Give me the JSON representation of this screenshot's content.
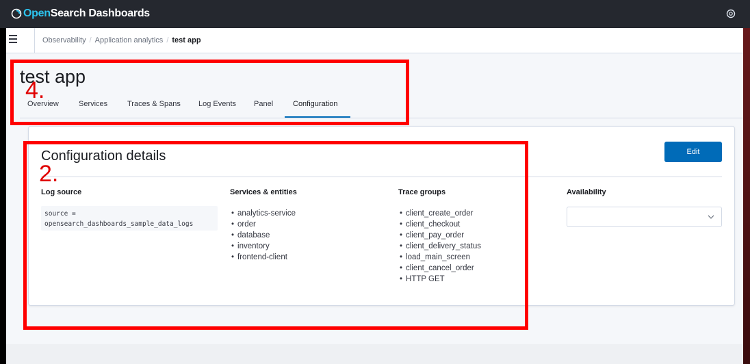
{
  "header": {
    "brand_prefix": "Open",
    "brand_suffix": "Search Dashboards",
    "logo_icon": "opensearch-logo-icon",
    "help_icon": "help-icon"
  },
  "breadcrumbs": {
    "items": [
      "Observability",
      "Application analytics"
    ],
    "current": "test app",
    "separator": "/"
  },
  "page": {
    "title": "test app",
    "tabs": [
      "Overview",
      "Services",
      "Traces & Spans",
      "Log Events",
      "Panel",
      "Configuration"
    ],
    "active_tab": "Configuration"
  },
  "config": {
    "title": "Configuration details",
    "edit_label": "Edit",
    "log_source": {
      "heading": "Log source",
      "query": "source =\nopensearch_dashboards_sample_data_logs"
    },
    "services": {
      "heading": "Services & entities",
      "items": [
        "analytics-service",
        "order",
        "database",
        "inventory",
        "frontend-client"
      ]
    },
    "trace_groups": {
      "heading": "Trace groups",
      "items": [
        "client_create_order",
        "client_checkout",
        "client_pay_order",
        "client_delivery_status",
        "load_main_screen",
        "client_cancel_order",
        "HTTP GET"
      ]
    },
    "availability": {
      "heading": "Availability",
      "selected": ""
    }
  },
  "annotations": {
    "label_tabs": "4.",
    "label_details": "2.",
    "color": "#ff0000"
  },
  "colors": {
    "primary": "#006bb8",
    "header_bg": "#25282f",
    "brand_accent": "#2cc4ef"
  }
}
